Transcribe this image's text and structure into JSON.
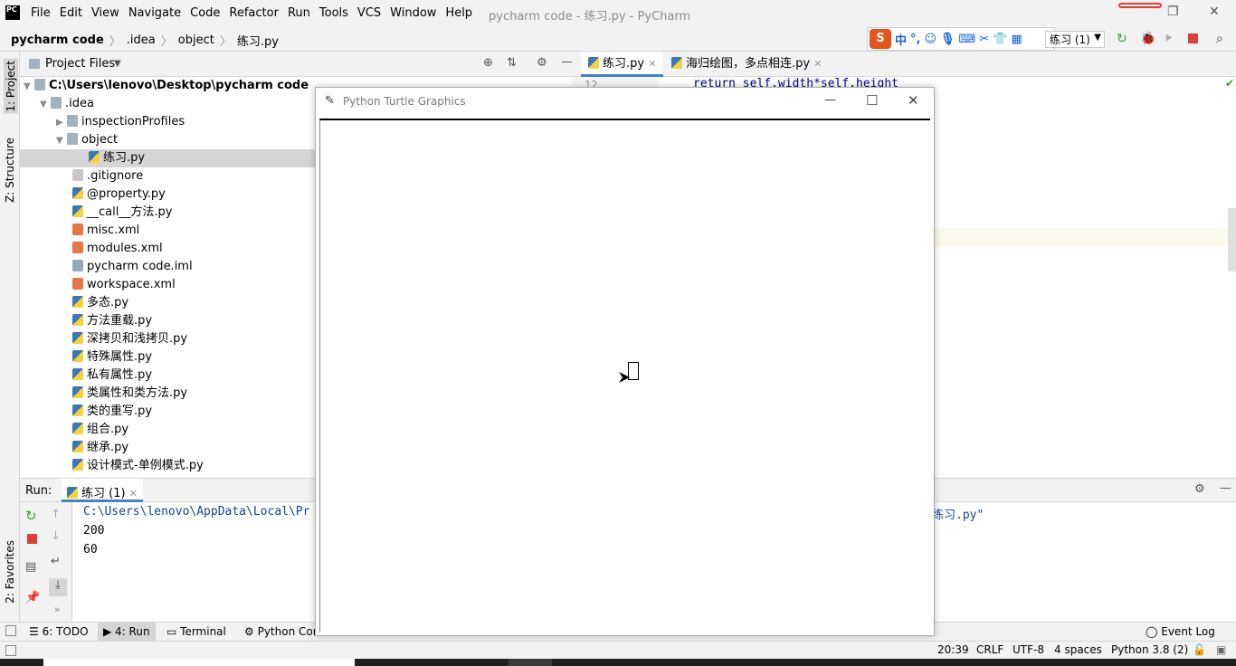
{
  "menubar": {
    "logo": "PC",
    "items": [
      "File",
      "Edit",
      "View",
      "Navigate",
      "Code",
      "Refactor",
      "Run",
      "Tools",
      "VCS",
      "Window",
      "Help"
    ],
    "title": "pycharm code - 练习.py - PyCharm"
  },
  "breadcrumb": [
    "pycharm code",
    ".idea",
    "object",
    "练习.py"
  ],
  "ime": {
    "logo": "S",
    "mode": "中",
    "punct": "°,"
  },
  "run_config": "练习 (1)",
  "left_strip": {
    "project": "1: Project",
    "structure": "Z: Structure",
    "favorites": "2: Favorites"
  },
  "project_panel": {
    "title": "Project Files"
  },
  "tree": [
    {
      "label": "C:\\Users\\lenovo\\Desktop\\pycharm code",
      "icon": "folder",
      "arrow": "▼"
    },
    {
      "label": ".idea",
      "icon": "folder",
      "arrow": "▼"
    },
    {
      "label": "inspectionProfiles",
      "icon": "folder",
      "arrow": "▶"
    },
    {
      "label": "object",
      "icon": "folder",
      "arrow": "▼"
    },
    {
      "label": "练习.py",
      "icon": "py",
      "arrow": ""
    },
    {
      "label": ".gitignore",
      "icon": "git",
      "arrow": ""
    },
    {
      "label": "@property.py",
      "icon": "py",
      "arrow": ""
    },
    {
      "label": "__call__方法.py",
      "icon": "py",
      "arrow": ""
    },
    {
      "label": "misc.xml",
      "icon": "xml",
      "arrow": ""
    },
    {
      "label": "modules.xml",
      "icon": "xml",
      "arrow": ""
    },
    {
      "label": "pycharm code.iml",
      "icon": "iml",
      "arrow": ""
    },
    {
      "label": "workspace.xml",
      "icon": "xml",
      "arrow": ""
    },
    {
      "label": "多态.py",
      "icon": "py",
      "arrow": ""
    },
    {
      "label": "方法重载.py",
      "icon": "py",
      "arrow": ""
    },
    {
      "label": "深拷贝和浅拷贝.py",
      "icon": "py",
      "arrow": ""
    },
    {
      "label": "特殊属性.py",
      "icon": "py",
      "arrow": ""
    },
    {
      "label": "私有属性.py",
      "icon": "py",
      "arrow": ""
    },
    {
      "label": "类属性和类方法.py",
      "icon": "py",
      "arrow": ""
    },
    {
      "label": "类的重写.py",
      "icon": "py",
      "arrow": ""
    },
    {
      "label": "组合.py",
      "icon": "py",
      "arrow": ""
    },
    {
      "label": "继承.py",
      "icon": "py",
      "arrow": ""
    },
    {
      "label": "设计模式-单例模式.py",
      "icon": "py",
      "arrow": ""
    }
  ],
  "editor_tabs": [
    "练习.py",
    "海归绘图，多点相连.py"
  ],
  "editor": {
    "line_no": "12",
    "code_line": "return self.width*self.height"
  },
  "run_panel": {
    "label": "Run:",
    "tab": "练习 (1)"
  },
  "console": {
    "path_line": "C:\\Users\\lenovo\\AppData\\Local\\Pr",
    "path_end": "练习.py\"",
    "lines": [
      "200",
      "60"
    ]
  },
  "bottom_tabs": [
    "6: TODO",
    "4: Run",
    "Terminal",
    "Python Con"
  ],
  "event_log": "Event Log",
  "status": {
    "position": "20:39",
    "line_sep": "CRLF",
    "encoding": "UTF-8",
    "indent": "4 spaces",
    "interpreter": "Python 3.8 (2)"
  },
  "turtle": {
    "title": "Python Turtle Graphics"
  }
}
